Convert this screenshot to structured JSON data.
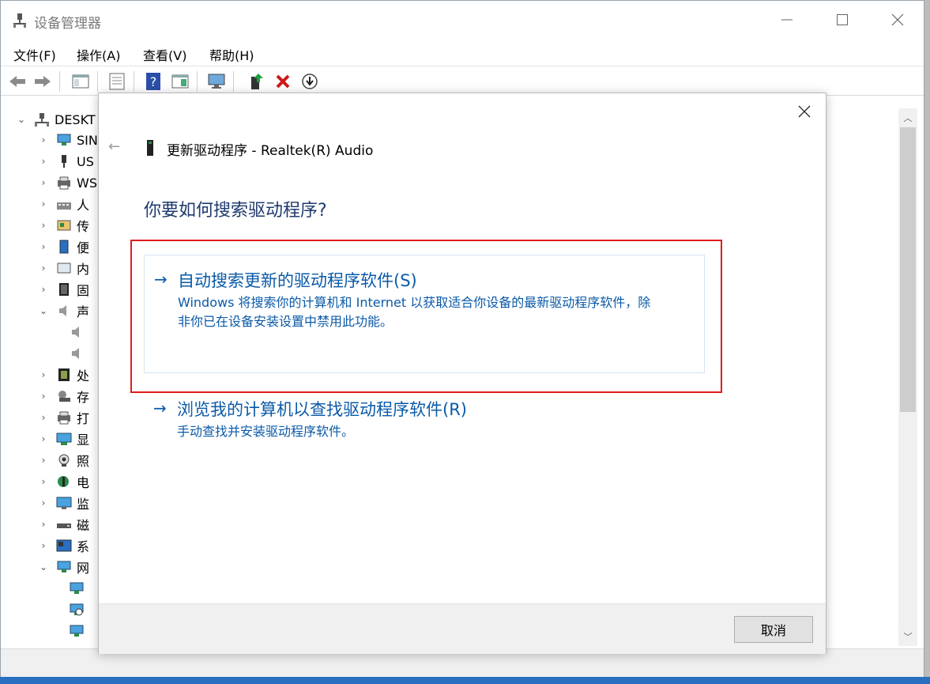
{
  "window": {
    "title": "设备管理器"
  },
  "menu": [
    "文件(F)",
    "操作(A)",
    "查看(V)",
    "帮助(H)"
  ],
  "tree": {
    "root": "DESKT",
    "items": [
      "SIN",
      "US",
      "WS",
      "人",
      "传",
      "便",
      "内",
      "固",
      "声",
      "",
      "",
      "处",
      "存",
      "打",
      "显",
      "照",
      "电",
      "监",
      "磁",
      "系",
      "网",
      "",
      "",
      ""
    ]
  },
  "dialog": {
    "title": "更新驱动程序 - Realtek(R) Audio",
    "question": "你要如何搜索驱动程序?",
    "option1": {
      "title": "自动搜索更新的驱动程序软件(S)",
      "desc_line1": "Windows 将搜索你的计算机和 Internet 以获取适合你设备的最新驱动程序软件，除",
      "desc_line2": "非你已在设备安装设置中禁用此功能。"
    },
    "option2": {
      "title": "浏览我的计算机以查找驱动程序软件(R)",
      "desc": "手动查找并安装驱动程序软件。"
    },
    "cancel_label": "取消"
  },
  "colors": {
    "link": "#0a5aa8",
    "question": "#1f3a6e",
    "highlight": "#e11c1c"
  }
}
